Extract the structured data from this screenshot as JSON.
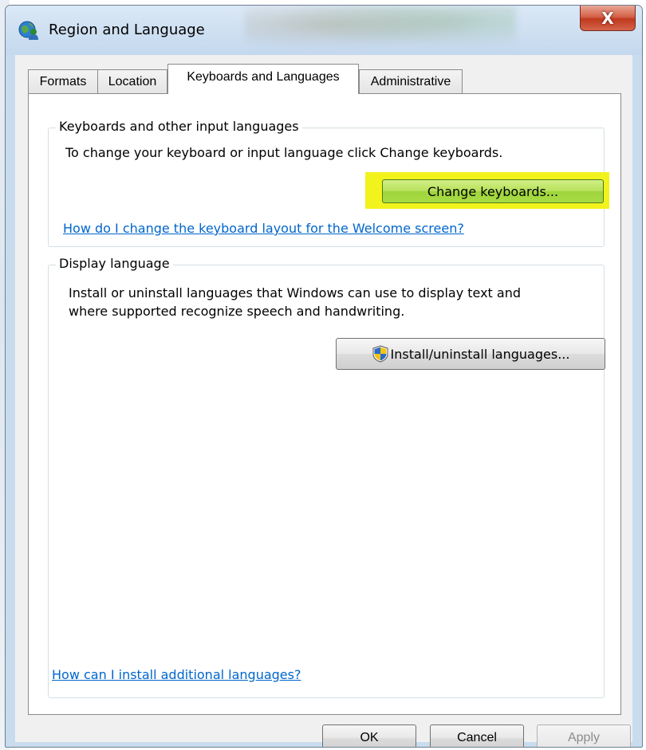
{
  "window": {
    "title": "Region and Language",
    "close_symbol": "X"
  },
  "tabs": [
    {
      "label": "Formats",
      "active": false
    },
    {
      "label": "Location",
      "active": false
    },
    {
      "label": "Keyboards and Languages",
      "active": true
    },
    {
      "label": "Administrative",
      "active": false
    }
  ],
  "keyboards_group": {
    "title": "Keyboards and other input languages",
    "description": "To change your keyboard or input language click Change keyboards.",
    "change_button": "Change keyboards...",
    "welcome_link": "How do I change the keyboard layout for the Welcome screen?"
  },
  "display_group": {
    "title": "Display language",
    "description_line1": "Install or uninstall languages that Windows can use to display text and",
    "description_line2": "where supported recognize speech and handwriting.",
    "install_button": "Install/uninstall languages..."
  },
  "footer_link": "How can I install additional languages?",
  "buttons": {
    "ok": "OK",
    "cancel": "Cancel",
    "apply": "Apply",
    "apply_enabled": false
  },
  "colors": {
    "link": "#0066cc",
    "highlight": "#f2f21c",
    "change_button": "#a9dc44",
    "close_button": "#c0391f"
  },
  "icons": {
    "app": "globe-person-icon",
    "shield": "uac-shield-icon"
  }
}
